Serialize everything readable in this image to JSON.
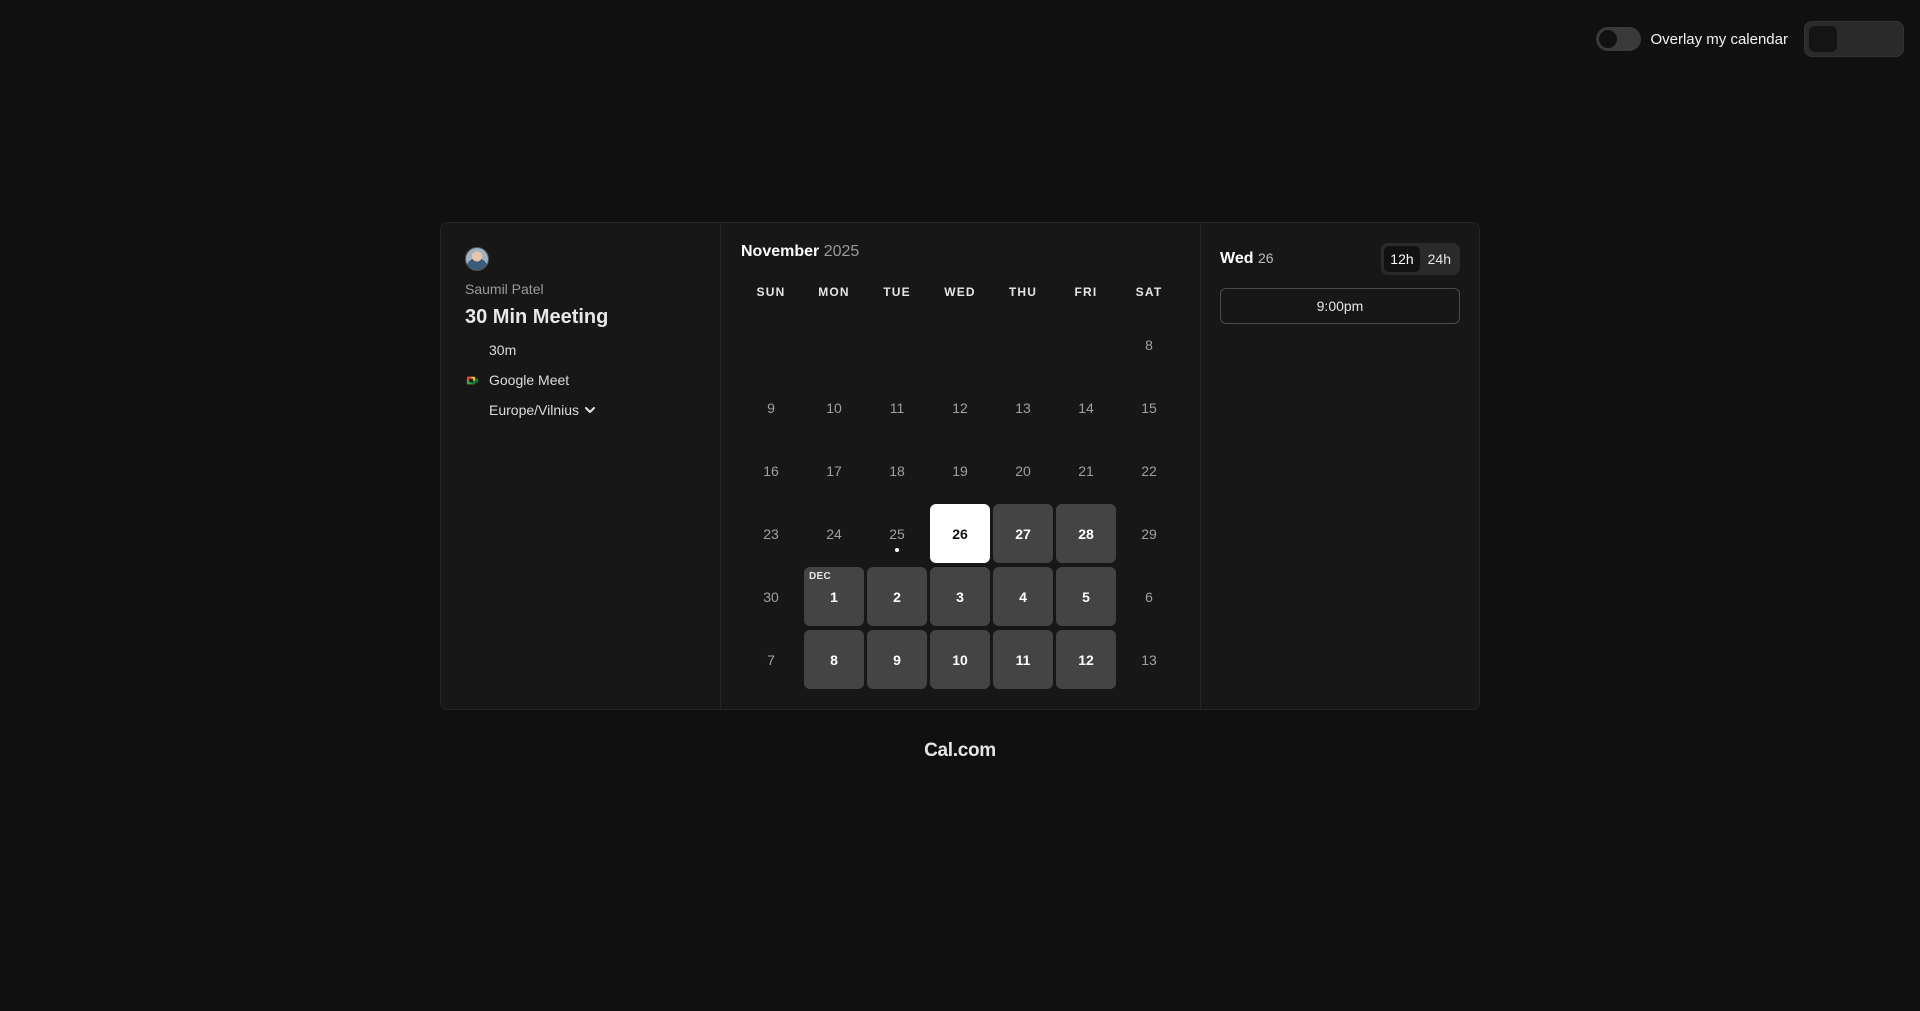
{
  "topbar": {
    "overlay_label": "Overlay my calendar",
    "overlay_on": false
  },
  "meta": {
    "organizer": "Saumil Patel",
    "event_title": "30 Min Meeting",
    "duration": "30m",
    "location": "Google Meet",
    "timezone": "Europe/Vilnius"
  },
  "calendar": {
    "month": "November",
    "year": "2025",
    "weekdays": [
      "SUN",
      "MON",
      "TUE",
      "WED",
      "THU",
      "FRI",
      "SAT"
    ],
    "weeks": [
      [
        {
          "d": ""
        },
        {
          "d": ""
        },
        {
          "d": ""
        },
        {
          "d": ""
        },
        {
          "d": ""
        },
        {
          "d": ""
        },
        {
          "d": "8",
          "s": "off"
        }
      ],
      [
        {
          "d": "9",
          "s": "off"
        },
        {
          "d": "10",
          "s": "off"
        },
        {
          "d": "11",
          "s": "off"
        },
        {
          "d": "12",
          "s": "off"
        },
        {
          "d": "13",
          "s": "off"
        },
        {
          "d": "14",
          "s": "off"
        },
        {
          "d": "15",
          "s": "off"
        }
      ],
      [
        {
          "d": "16",
          "s": "off"
        },
        {
          "d": "17",
          "s": "off"
        },
        {
          "d": "18",
          "s": "off"
        },
        {
          "d": "19",
          "s": "off"
        },
        {
          "d": "20",
          "s": "off"
        },
        {
          "d": "21",
          "s": "off"
        },
        {
          "d": "22",
          "s": "off"
        }
      ],
      [
        {
          "d": "23",
          "s": "off"
        },
        {
          "d": "24",
          "s": "off"
        },
        {
          "d": "25",
          "s": "today"
        },
        {
          "d": "26",
          "s": "selected"
        },
        {
          "d": "27",
          "s": "available"
        },
        {
          "d": "28",
          "s": "available"
        },
        {
          "d": "29",
          "s": "off"
        }
      ],
      [
        {
          "d": "30",
          "s": "off"
        },
        {
          "d": "1",
          "s": "available",
          "tag": "DEC"
        },
        {
          "d": "2",
          "s": "available"
        },
        {
          "d": "3",
          "s": "available"
        },
        {
          "d": "4",
          "s": "available"
        },
        {
          "d": "5",
          "s": "available"
        },
        {
          "d": "6",
          "s": "off"
        }
      ],
      [
        {
          "d": "7",
          "s": "off"
        },
        {
          "d": "8",
          "s": "available"
        },
        {
          "d": "9",
          "s": "available"
        },
        {
          "d": "10",
          "s": "available"
        },
        {
          "d": "11",
          "s": "available"
        },
        {
          "d": "12",
          "s": "available"
        },
        {
          "d": "13",
          "s": "off"
        }
      ]
    ]
  },
  "slots": {
    "day_name": "Wed",
    "day_num": "26",
    "format_12h": "12h",
    "format_24h": "24h",
    "active_format": "12h",
    "times": [
      "9:00pm"
    ]
  },
  "brand": "Cal.com"
}
